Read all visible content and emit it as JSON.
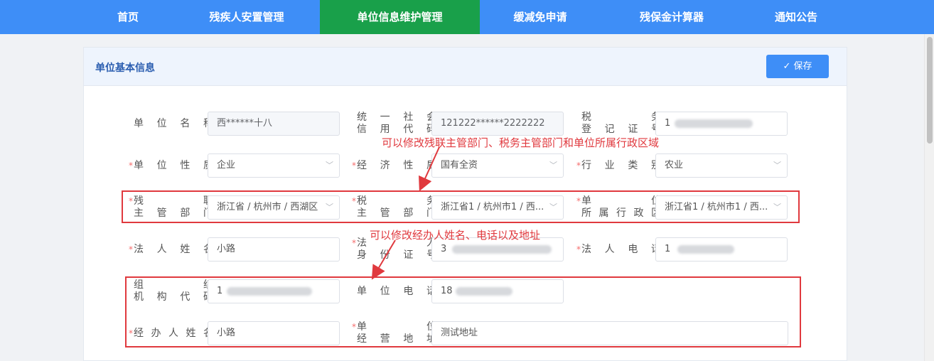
{
  "nav": {
    "items": [
      {
        "label": "首页"
      },
      {
        "label": "残疾人安置管理"
      },
      {
        "label": "单位信息维护管理"
      },
      {
        "label": "缓减免申请"
      },
      {
        "label": "残保金计算器"
      },
      {
        "label": "通知公告"
      }
    ],
    "active_index": 2
  },
  "card": {
    "title": "单位基本信息",
    "save_label": "保存",
    "save_icon": "check-icon"
  },
  "form": {
    "unit_name": {
      "label": "单位名称",
      "value": "西******十八",
      "required": false
    },
    "credit_code": {
      "label_line1": "统一社会",
      "label_line2": "信用代码",
      "value": "121222******2222222",
      "required": false
    },
    "tax_reg_no": {
      "label_line1": "税务",
      "label_line2": "登记证号",
      "value": "1",
      "required": false
    },
    "unit_nature": {
      "label": "单位性质",
      "value": "企业",
      "required": true
    },
    "economic_nature": {
      "label": "经济性质",
      "value": "国有全资",
      "required": true
    },
    "industry": {
      "label": "行业类别",
      "value": "农业",
      "required": true
    },
    "disabled_fed_dept": {
      "label_line1": "残联",
      "label_line2": "主管部门",
      "value": "浙江省 / 杭州市 / 西湖区",
      "required": true
    },
    "tax_dept": {
      "label_line1": "税务",
      "label_line2": "主管部门",
      "value": "浙江省1 / 杭州市1 / 西...",
      "required": true
    },
    "unit_region": {
      "label_line1": "单位",
      "label_line2": "所属行政区",
      "value": "浙江省1 / 杭州市1 / 西...",
      "required": true
    },
    "legal_name": {
      "label": "法人姓名",
      "value": "小路",
      "required": true
    },
    "legal_id": {
      "label_line1": "法人",
      "label_line2": "身份证号",
      "value": "3",
      "required": true
    },
    "legal_phone": {
      "label": "法人电话",
      "value": "1",
      "required": true
    },
    "org_code": {
      "label_line1": "组织",
      "label_line2": "机构代码",
      "value": "1",
      "required": false
    },
    "unit_phone": {
      "label": "单位电话",
      "value": "18",
      "required": false
    },
    "agent_name": {
      "label": "经办人姓名",
      "value": "小路",
      "required": true
    },
    "business_address": {
      "label_line1": "单位",
      "label_line2": "经营地址",
      "value": "测试地址",
      "required": true
    }
  },
  "annotations": {
    "note1": "可以修改残联主管部门、税务主管部门和单位所属行政区域",
    "note2": "可以修改经办人姓名、电话以及地址"
  },
  "colors": {
    "nav_bg": "#3e8ef7",
    "nav_active": "#19a04a",
    "annotation_red": "#e0393e",
    "required_star": "#f56c6c"
  }
}
